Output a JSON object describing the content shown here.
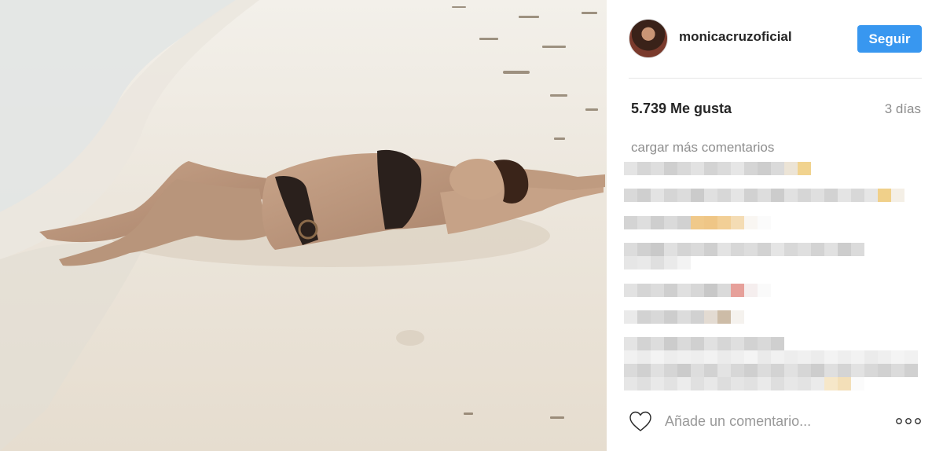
{
  "post": {
    "photo_subject": "woman-on-beach",
    "username": "monicacruzoficial",
    "follow_label": "Seguir",
    "likes": "5.739 Me gusta",
    "time_ago": "3 días",
    "load_more_label": "cargar más comentarios",
    "comment_placeholder": "Añade un comentario...",
    "icons": {
      "like": "heart-icon",
      "options": "more-options-icon"
    },
    "colors": {
      "follow_button": "#3897f0",
      "muted_text": "#8e8e8e"
    }
  }
}
